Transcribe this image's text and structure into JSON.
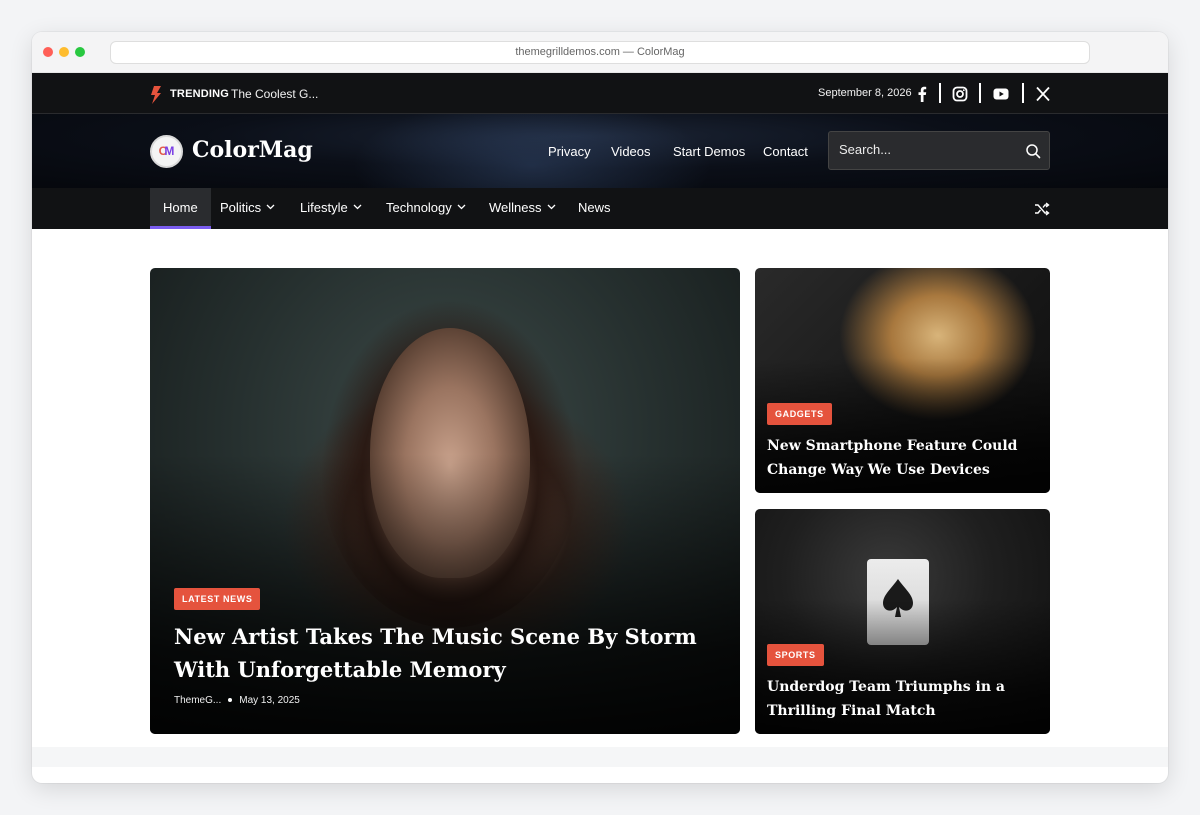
{
  "browser": {
    "url": "themegrilldemos.com — ColorMag"
  },
  "topbar": {
    "trending_label": "TRENDING",
    "trending_text": "The Coolest G...",
    "date": "September 8, 2026",
    "social_icons": [
      "facebook-icon",
      "instagram-icon",
      "youtube-icon",
      "x-icon"
    ]
  },
  "header": {
    "logo_letters": {
      "c": "C",
      "m": "M"
    },
    "site_name": "ColorMag",
    "nav": [
      "Privacy",
      "Videos",
      "Start Demos",
      "Contact"
    ],
    "search_placeholder": "Search..."
  },
  "mainnav": {
    "items": [
      {
        "label": "Home",
        "active": true
      },
      {
        "label": "Politics",
        "dropdown": true
      },
      {
        "label": "Lifestyle",
        "dropdown": true
      },
      {
        "label": "Technology",
        "dropdown": true
      },
      {
        "label": "Wellness",
        "dropdown": true
      },
      {
        "label": "News"
      }
    ],
    "accent": "#7a5cf0"
  },
  "featured": {
    "main": {
      "category": "LATEST NEWS",
      "title": "New Artist Takes The Music Scene By Storm With Unforgettable Memory",
      "author": "ThemeG...",
      "date": "May 13, 2025"
    },
    "side": [
      {
        "category": "GADGETS",
        "title": "New Smartphone Feature Could Change Way We Use Devices"
      },
      {
        "category": "SPORTS",
        "title": "Underdog Team Triumphs in a Thrilling Final Match"
      }
    ]
  },
  "colors": {
    "badge": "#e5533d",
    "dark_bar": "#111214"
  }
}
